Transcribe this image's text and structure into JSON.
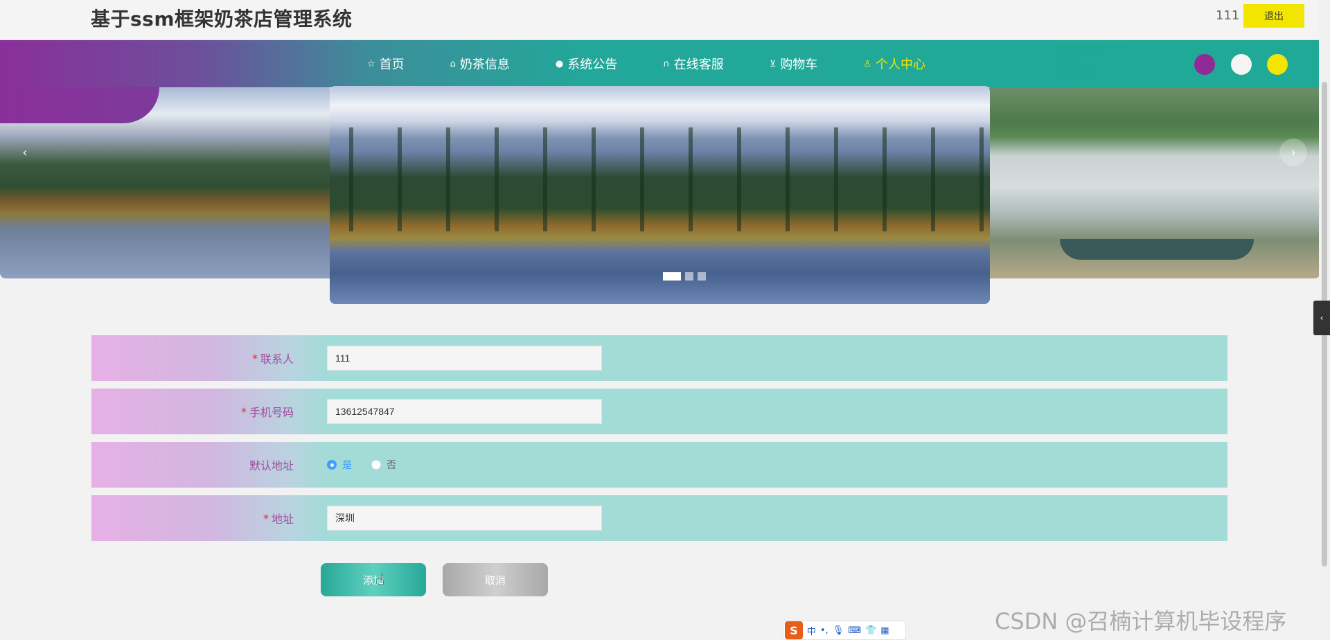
{
  "header": {
    "site_title": "基于ssm框架奶茶店管理系统",
    "username": "111",
    "logout_label": "退出"
  },
  "nav": {
    "items": [
      {
        "label": "首页",
        "icon": "star-icon",
        "active": false
      },
      {
        "label": "奶茶信息",
        "icon": "bag-icon",
        "active": false
      },
      {
        "label": "系统公告",
        "icon": "info-icon",
        "active": false
      },
      {
        "label": "在线客服",
        "icon": "headset-icon",
        "active": false
      },
      {
        "label": "购物车",
        "icon": "cart-icon",
        "active": false
      },
      {
        "label": "个人中心",
        "icon": "user-icon",
        "active": true
      }
    ],
    "theme_colors": [
      "#8e2b95",
      "#f5f5f5",
      "#f2e600"
    ],
    "accent_active": "#f2e600"
  },
  "carousel": {
    "slide_count": 3,
    "active_slide": 1,
    "prev_icon": "‹",
    "next_icon": "›"
  },
  "form": {
    "contact": {
      "label": "联系人",
      "required": true,
      "value": "111"
    },
    "phone": {
      "label": "手机号码",
      "required": true,
      "value": "13612547847"
    },
    "default_address": {
      "label": "默认地址",
      "required": false,
      "options": [
        "是",
        "否"
      ],
      "selected": "是"
    },
    "address": {
      "label": "地址",
      "required": true,
      "value": "深圳"
    }
  },
  "actions": {
    "submit_label": "添加",
    "cancel_label": "取消"
  },
  "side_tab": {
    "icon": "‹"
  },
  "ime": {
    "mode": "中"
  },
  "watermark": "CSDN @召楠计算机毕设程序"
}
